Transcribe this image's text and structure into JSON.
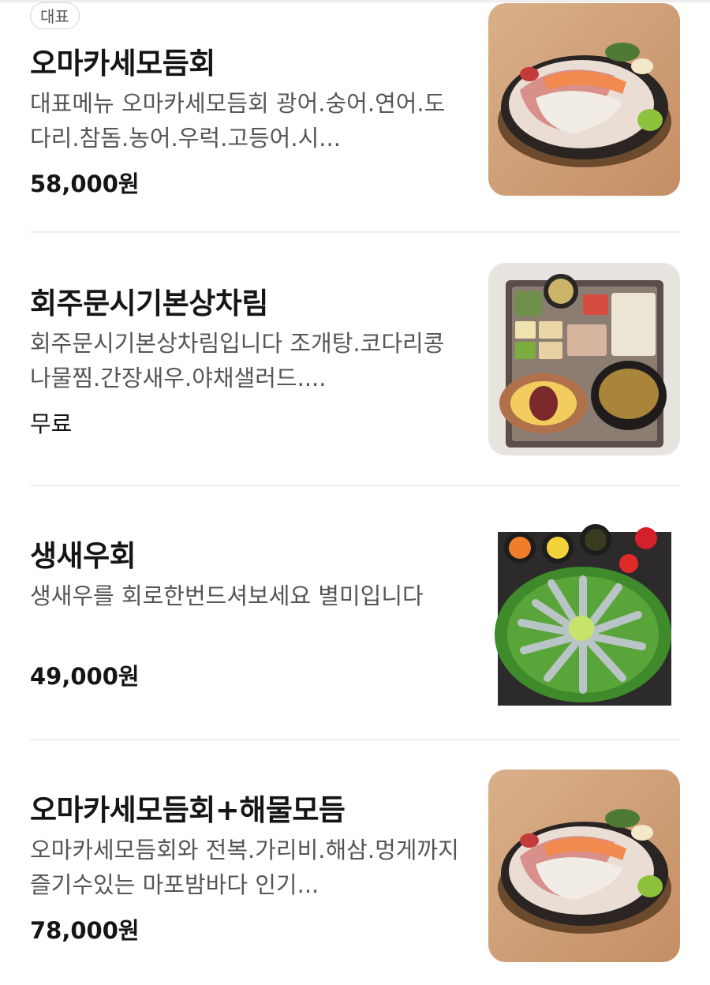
{
  "menu": {
    "items": [
      {
        "badge": "대표",
        "name": "오마카세모듬회",
        "description": "대표메뉴 오마카세모듬회 광어.숭어.연어.도다리.참돔.농어.우럭.고등어.시...",
        "price": "58,000원",
        "image_icon": "sashimi-platter-photo"
      },
      {
        "name": "회주문시기본상차림",
        "description": "회주문시기본상차림입니다 조개탕.코다리콩나물찜.간장새우.야채샐러드....",
        "price": "무료",
        "image_icon": "side-dishes-tray-photo"
      },
      {
        "name": "생새우회",
        "description": "생새우를 회로한번드셔보세요 별미입니다",
        "price": "49,000원",
        "image_icon": "raw-shrimp-photo"
      },
      {
        "name": "오마카세모듬회+해물모듬",
        "description": "오마카세모듬회와 전복.가리비.해삼.멍게까지즐기수있는 마포밤바다 인기...",
        "price": "78,000원",
        "image_icon": "sashimi-platter-photo"
      }
    ]
  }
}
